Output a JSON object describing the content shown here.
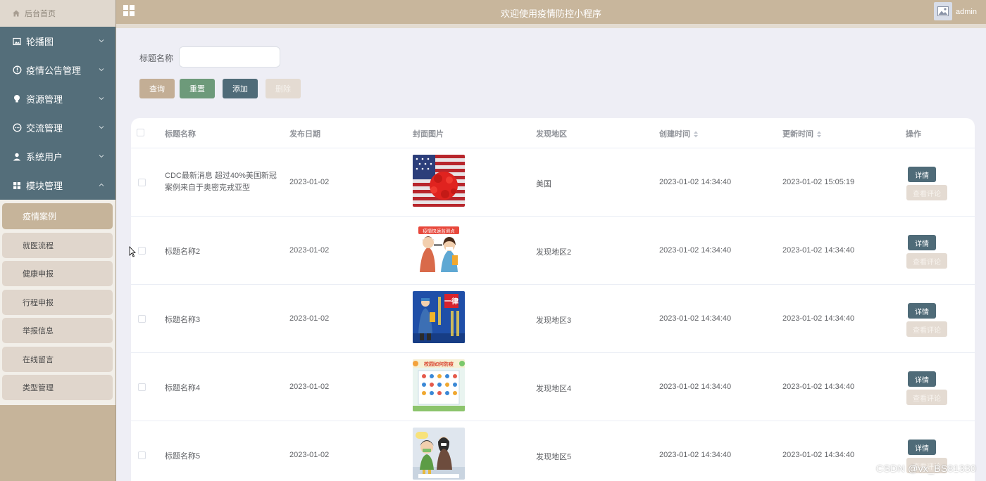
{
  "sidebar": {
    "home_label": "后台首页",
    "menus": [
      {
        "label": "轮播图",
        "icon": "image-icon"
      },
      {
        "label": "疫情公告管理",
        "icon": "info-circle-icon"
      },
      {
        "label": "资源管理",
        "icon": "lightbulb-icon"
      },
      {
        "label": "交流管理",
        "icon": "chat-bubble-icon"
      },
      {
        "label": "系统用户",
        "icon": "user-icon"
      },
      {
        "label": "模块管理",
        "icon": "grid-icon",
        "expanded": true
      }
    ],
    "submenu": [
      {
        "label": "疫情案例",
        "active": true
      },
      {
        "label": "就医流程"
      },
      {
        "label": "健康申报"
      },
      {
        "label": "行程申报"
      },
      {
        "label": "举报信息"
      },
      {
        "label": "在线留言"
      },
      {
        "label": "类型管理"
      }
    ]
  },
  "header": {
    "title": "欢迎使用疫情防控小程序",
    "username": "admin"
  },
  "search": {
    "label": "标题名称",
    "value": "",
    "placeholder": ""
  },
  "toolbar": {
    "query": "查询",
    "reset": "重置",
    "add": "添加",
    "delete": "删除"
  },
  "table": {
    "headers": {
      "title": "标题名称",
      "publish_date": "发布日期",
      "cover": "封面图片",
      "region": "发现地区",
      "created": "创建时间",
      "updated": "更新时间",
      "actions": "操作"
    },
    "detail_label": "详情",
    "comment_label": "查看评论",
    "rows": [
      {
        "title": "CDC最新消息 超过40%美国新冠案例来自于奥密克戎亚型",
        "publish_date": "2023-01-02",
        "region": "美国",
        "created": "2023-01-02 14:34:40",
        "updated": "2023-01-02 15:05:19",
        "image": "us-flag-virus"
      },
      {
        "title": "标题名称2",
        "publish_date": "2023-01-02",
        "region": "发现地区2",
        "created": "2023-01-02 14:34:40",
        "updated": "2023-01-02 14:34:40",
        "image": "temperature-check",
        "image_text": "疫情快速监测点"
      },
      {
        "title": "标题名称3",
        "publish_date": "2023-01-02",
        "region": "发现地区3",
        "created": "2023-01-02 14:34:40",
        "updated": "2023-01-02 14:34:40",
        "image": "poster-blue",
        "image_text": "一律"
      },
      {
        "title": "标题名称4",
        "publish_date": "2023-01-02",
        "region": "发现地区4",
        "created": "2023-01-02 14:34:40",
        "updated": "2023-01-02 14:34:40",
        "image": "campus-poster",
        "image_text": "校园如何防疫"
      },
      {
        "title": "标题名称5",
        "publish_date": "2023-01-02",
        "region": "发现地区5",
        "created": "2023-01-02 14:34:40",
        "updated": "2023-01-02 14:34:40",
        "image": "cartoon-mask"
      }
    ]
  },
  "watermark": "CSDN @vx_BS81330",
  "colors": {
    "primary_tan": "#c6b49a",
    "menu_slate": "#546e7a",
    "detail_button": "#4f6b78",
    "reset_green": "#6d9a7a"
  }
}
